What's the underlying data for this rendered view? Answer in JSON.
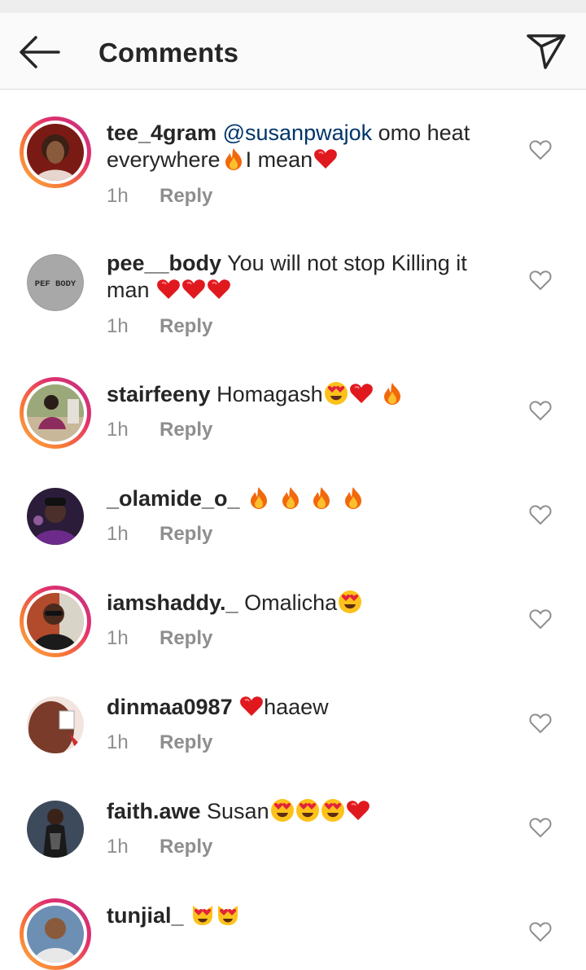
{
  "header": {
    "title": "Comments",
    "back_icon": "arrow-left-icon",
    "share_icon": "paper-plane-icon"
  },
  "comments": [
    {
      "username": "tee_4gram",
      "mention": "@susanpwajok",
      "text_line1": " omo heat",
      "text_line2a": "everywhere",
      "text_line2b": "I mean",
      "time": "1h",
      "reply": "Reply"
    },
    {
      "username": "pee__body",
      "text": " You will not stop Killing it man ",
      "avatar_text": "PEF BODY",
      "time": "1h",
      "reply": "Reply"
    },
    {
      "username": "stairfeeny",
      "text": " Homagash",
      "time": "1h",
      "reply": "Reply"
    },
    {
      "username": "_olamide_o_",
      "text": " ",
      "time": "1h",
      "reply": "Reply"
    },
    {
      "username": "iamshaddy._",
      "text": " Omalicha",
      "time": "1h",
      "reply": "Reply"
    },
    {
      "username": "dinmaa0987",
      "text": "haaew",
      "time": "1h",
      "reply": "Reply"
    },
    {
      "username": "faith.awe",
      "text": " Susan",
      "time": "1h",
      "reply": "Reply"
    },
    {
      "username": "tunjial_",
      "text": " ",
      "time": "",
      "reply": ""
    }
  ]
}
